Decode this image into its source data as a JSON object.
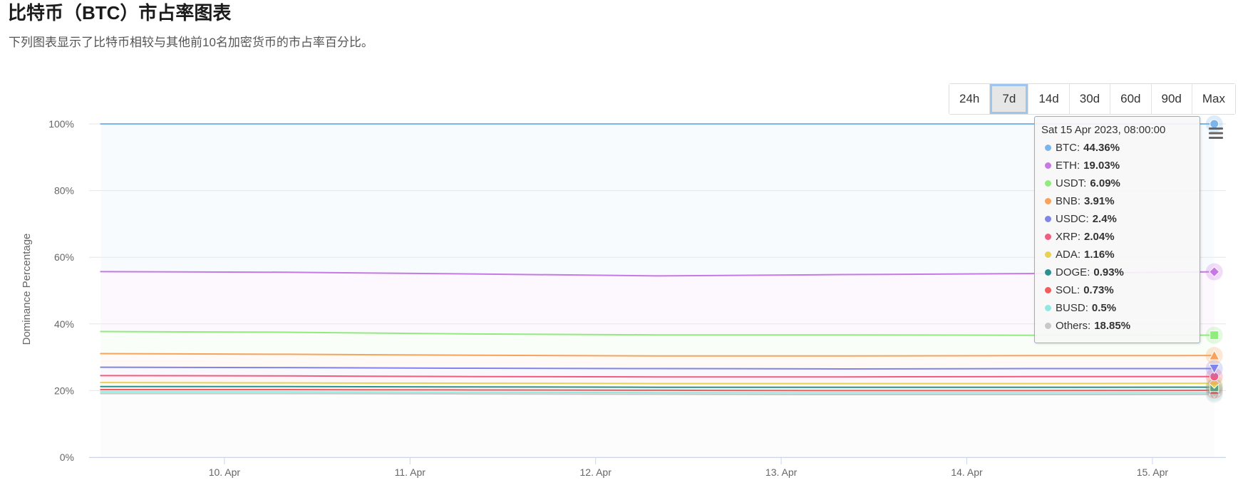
{
  "page": {
    "title": "比特币（BTC）市占率图表",
    "subtitle": "下列图表显示了比特币相较与其他前10名加密货币的市占率百分比。"
  },
  "range_selector": {
    "buttons": [
      "24h",
      "7d",
      "14d",
      "30d",
      "60d",
      "90d",
      "Max"
    ],
    "selected": "7d"
  },
  "chart_menu": {
    "icon": "hamburger-menu-icon"
  },
  "tooltip": {
    "title": "Sat 15 Apr 2023, 08:00:00",
    "point_index": 6,
    "value_suffix": "%"
  },
  "chart_data": {
    "type": "line",
    "stacking": "percent",
    "ylabel": "Dominance Percentage",
    "ylim": [
      0,
      100
    ],
    "y_ticks": [
      {
        "value": 0,
        "label": "0%"
      },
      {
        "value": 20,
        "label": "20%"
      },
      {
        "value": 40,
        "label": "40%"
      },
      {
        "value": 60,
        "label": "60%"
      },
      {
        "value": 80,
        "label": "80%"
      },
      {
        "value": 100,
        "label": "100%"
      }
    ],
    "xlim": [
      "2023-04-09T06:30",
      "2023-04-15T09:30"
    ],
    "x_ticks": [
      {
        "value": "2023-04-10T00:00",
        "label": "10. Apr"
      },
      {
        "value": "2023-04-11T00:00",
        "label": "11. Apr"
      },
      {
        "value": "2023-04-12T00:00",
        "label": "12. Apr"
      },
      {
        "value": "2023-04-13T00:00",
        "label": "13. Apr"
      },
      {
        "value": "2023-04-14T00:00",
        "label": "14. Apr"
      },
      {
        "value": "2023-04-15T00:00",
        "label": "15. Apr"
      }
    ],
    "grid": true,
    "x": [
      "2023-04-09T08:00",
      "2023-04-10T08:00",
      "2023-04-11T08:00",
      "2023-04-12T08:00",
      "2023-04-13T08:00",
      "2023-04-14T08:00",
      "2023-04-15T08:00"
    ],
    "series": [
      {
        "name": "BTC",
        "color": "#7cb5ec",
        "marker": "circle",
        "values": [
          44.3,
          44.5,
          45.0,
          45.6,
          45.2,
          44.9,
          44.36
        ]
      },
      {
        "name": "ETH",
        "color": "#c679e3",
        "marker": "diamond",
        "values": [
          18.0,
          18.0,
          18.0,
          17.7,
          18.1,
          18.5,
          19.03
        ]
      },
      {
        "name": "USDT",
        "color": "#90ed7d",
        "marker": "square",
        "values": [
          6.6,
          6.6,
          6.4,
          6.3,
          6.3,
          6.1,
          6.09
        ]
      },
      {
        "name": "BNB",
        "color": "#f7a35c",
        "marker": "triangle",
        "values": [
          4.1,
          4.0,
          3.9,
          3.8,
          3.9,
          3.9,
          3.91
        ]
      },
      {
        "name": "USDC",
        "color": "#8085e9",
        "marker": "triangle-down",
        "values": [
          2.5,
          2.5,
          2.5,
          2.5,
          2.4,
          2.4,
          2.4
        ]
      },
      {
        "name": "XRP",
        "color": "#f15c80",
        "marker": "circle",
        "values": [
          2.1,
          2.1,
          2.0,
          2.0,
          2.0,
          2.1,
          2.04
        ]
      },
      {
        "name": "ADA",
        "color": "#e4d354",
        "marker": "diamond",
        "values": [
          1.2,
          1.1,
          1.1,
          1.1,
          1.1,
          1.1,
          1.16
        ]
      },
      {
        "name": "DOGE",
        "color": "#2b908f",
        "marker": "square",
        "values": [
          0.9,
          0.9,
          0.9,
          0.9,
          1.0,
          1.0,
          0.93
        ]
      },
      {
        "name": "SOL",
        "color": "#f45b5b",
        "marker": "triangle",
        "values": [
          0.7,
          0.7,
          0.7,
          0.7,
          0.7,
          0.7,
          0.73
        ]
      },
      {
        "name": "BUSD",
        "color": "#91e8e1",
        "marker": "triangle-down",
        "values": [
          0.5,
          0.5,
          0.5,
          0.5,
          0.5,
          0.5,
          0.5
        ]
      },
      {
        "name": "Others",
        "color": "#c8c8c8",
        "marker": "circle",
        "values": [
          19.1,
          19.1,
          19.0,
          18.9,
          18.8,
          18.8,
          18.85
        ]
      }
    ]
  }
}
